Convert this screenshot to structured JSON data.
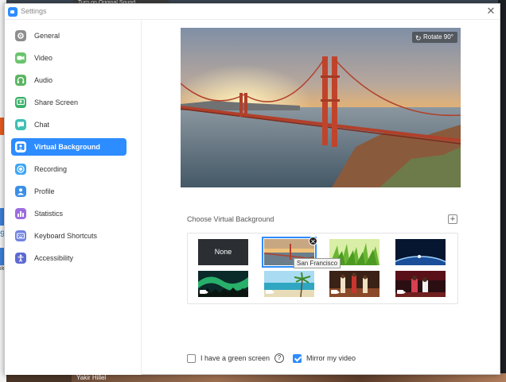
{
  "desktop": {
    "topbar_text": "Turn on Original Sound",
    "bottom_name": "Yakir Hillel",
    "left_fragment_1": "9",
    "left_fragment_2": "ile"
  },
  "window": {
    "title": "Settings",
    "close_glyph": "✕"
  },
  "sidebar": {
    "items": [
      {
        "label": "General",
        "icon": "gear-icon",
        "color": "#8e8e8e"
      },
      {
        "label": "Video",
        "icon": "video-camera-icon",
        "color": "#6ac46e"
      },
      {
        "label": "Audio",
        "icon": "headphones-icon",
        "color": "#5ab561"
      },
      {
        "label": "Share Screen",
        "icon": "share-screen-icon",
        "color": "#3bb06a"
      },
      {
        "label": "Chat",
        "icon": "chat-bubble-icon",
        "color": "#3fc0b4"
      },
      {
        "label": "Virtual Background",
        "icon": "person-background-icon",
        "color": "#2d8cff",
        "active": true
      },
      {
        "label": "Recording",
        "icon": "record-icon",
        "color": "#3fa6f4"
      },
      {
        "label": "Profile",
        "icon": "profile-icon",
        "color": "#3b8fe8"
      },
      {
        "label": "Statistics",
        "icon": "statistics-icon",
        "color": "#9b6ce0"
      },
      {
        "label": "Keyboard Shortcuts",
        "icon": "keyboard-icon",
        "color": "#7383e0"
      },
      {
        "label": "Accessibility",
        "icon": "accessibility-icon",
        "color": "#5e6ad2"
      }
    ]
  },
  "preview": {
    "rotate_label": "Rotate 90°",
    "rotate_glyph": "↻"
  },
  "virtual_background": {
    "choose_label": "Choose Virtual Background",
    "add_glyph": "+",
    "none_label": "None",
    "selected_tooltip": "San Francisco",
    "delete_glyph": "✕",
    "thumbnails": [
      "None",
      "San Francisco",
      "Grass",
      "Earth",
      "Aurora",
      "Beach",
      "Stage",
      "Concert"
    ]
  },
  "options": {
    "green_screen_label": "I have a green screen",
    "green_screen_checked": false,
    "help_glyph": "?",
    "mirror_label": "Mirror my video",
    "mirror_checked": true
  },
  "colors": {
    "accent": "#2d8cff"
  }
}
